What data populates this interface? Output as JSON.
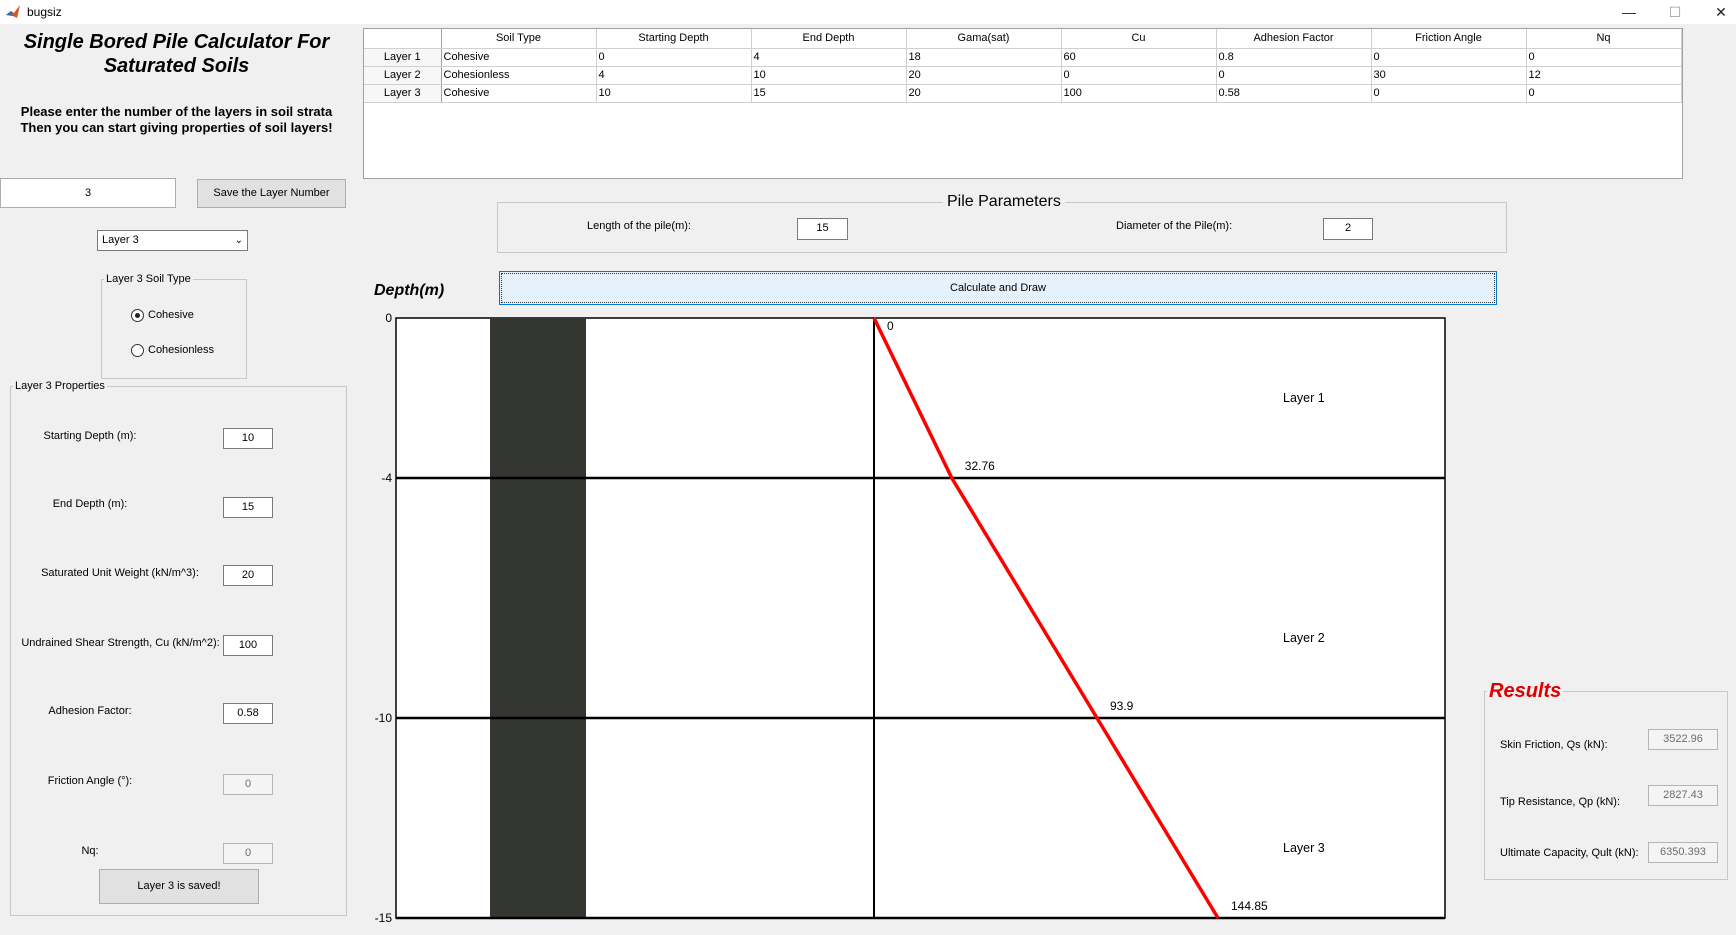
{
  "window": {
    "title": "bugsiz",
    "minimize_glyph": "—",
    "maximize_glyph": "☐",
    "close_glyph": "✕",
    "icon": "matlab-icon"
  },
  "left_panel": {
    "heading": "Single Bored Pile Calculator For Saturated Soils",
    "instructions_line1": "Please enter the number of the layers in soil strata",
    "instructions_line2": "Then you can start giving properties of soil layers!",
    "layer_count_value": "3",
    "save_layer_number_label": "Save the Layer Number",
    "layer_select_value": "Layer 3",
    "soil_type_group_title": "Layer 3 Soil Type",
    "soil_type_options": [
      "Cohesive",
      "Cohesionless"
    ],
    "soil_type_selected": "Cohesive",
    "properties_group_title": "Layer 3 Properties",
    "properties": [
      {
        "label": "Starting Depth (m):",
        "value": "10",
        "enabled": true
      },
      {
        "label": "End Depth (m):",
        "value": "15",
        "enabled": true
      },
      {
        "label": "Saturated Unit Weight (kN/m^3):",
        "value": "20",
        "enabled": true
      },
      {
        "label": "Undrained Shear Strength, Cu (kN/m^2):",
        "value": "100",
        "enabled": true
      },
      {
        "label": "Adhesion Factor:",
        "value": "0.58",
        "enabled": true
      },
      {
        "label": "Friction Angle (°):",
        "value": "0",
        "enabled": false
      },
      {
        "label": "Nq:",
        "value": "0",
        "enabled": false
      }
    ],
    "layer_saved_label": "Layer 3 is saved!"
  },
  "table": {
    "columns": [
      "Soil Type",
      "Starting Depth",
      "End Depth",
      "Gama(sat)",
      "Cu",
      "Adhesion Factor",
      "Friction Angle",
      "Nq"
    ],
    "rows": [
      {
        "name": "Layer 1",
        "cells": [
          "Cohesive",
          "0",
          "4",
          "18",
          "60",
          "0.8",
          "0",
          "0"
        ]
      },
      {
        "name": "Layer 2",
        "cells": [
          "Cohesionless",
          "4",
          "10",
          "20",
          "0",
          "0",
          "30",
          "12"
        ]
      },
      {
        "name": "Layer 3",
        "cells": [
          "Cohesive",
          "10",
          "15",
          "20",
          "100",
          "0.58",
          "0",
          "0"
        ]
      }
    ]
  },
  "pile_parameters": {
    "title": "Pile Parameters",
    "length_label": "Length of the pile(m):",
    "length_value": "15",
    "diameter_label": "Diameter of the Pile(m):",
    "diameter_value": "2"
  },
  "calculate_button_label": "Calculate and Draw",
  "chart_data": {
    "type": "line",
    "ylabel": "Depth(m)",
    "ylim": [
      -15,
      0
    ],
    "y_ticks": [
      0,
      -4,
      -10,
      -15
    ],
    "series": [
      {
        "x": [
          0,
          32.76,
          93.9,
          144.85
        ],
        "y": [
          0,
          -4,
          -10,
          -15
        ],
        "color": "#ff0000"
      }
    ],
    "point_labels": [
      "0",
      "32.76",
      "93.9",
      "144.85"
    ],
    "layer_boundaries": [
      -4,
      -10,
      -15
    ],
    "layer_labels": [
      {
        "text": "Layer 1",
        "depth": -2.0
      },
      {
        "text": "Layer 2",
        "depth": -8.0
      },
      {
        "text": "Layer 3",
        "depth": -13.25
      }
    ],
    "pile": {
      "color": "#343631",
      "depth": 15
    },
    "grid": false
  },
  "results": {
    "title": "Results",
    "items": [
      {
        "label": "Skin Friction, Qs (kN):",
        "value": "3522.96"
      },
      {
        "label": "Tip Resistance, Qp (kN):",
        "value": "2827.43"
      },
      {
        "label": "Ultimate Capacity, Qult (kN):",
        "value": "6350.393"
      }
    ]
  }
}
